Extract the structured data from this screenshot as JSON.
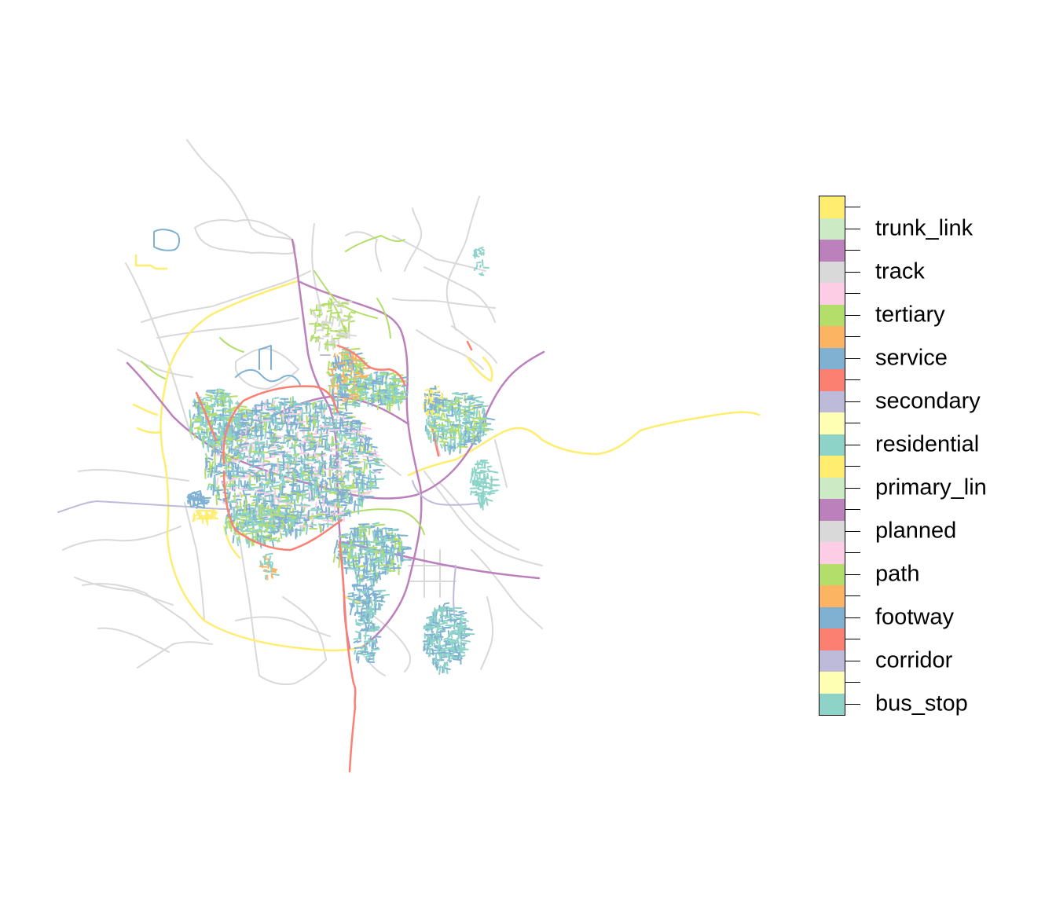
{
  "map": {
    "title": "",
    "palette": {
      "bus_stop": "#8DD3C7",
      "corridor": "#BEBADA",
      "footway": "#80B1D3",
      "path": "#B3DE69",
      "planned": "#D9D9D9",
      "primary_link": "#CCEBC5",
      "residential": "#8DD3C7",
      "secondary": "#FB8072",
      "service": "#80B1D3",
      "tertiary": "#B3DE69",
      "track": "#D9D9D9",
      "trunk_link": "#CCEBC5",
      "primary": "#FFED6F",
      "motorway": "#BC80BD",
      "unclassified": "#FFFFB3",
      "steps": "#FDB462",
      "pedestrian": "#FCCDE5",
      "living_street": "#FFFFB3"
    }
  },
  "legend": {
    "cells": [
      "#FFED6F",
      "#CCEBC5",
      "#BC80BD",
      "#D9D9D9",
      "#FCCDE5",
      "#B3DE69",
      "#FDB462",
      "#80B1D3",
      "#FB8072",
      "#BEBADA",
      "#FFFFB3",
      "#8DD3C7",
      "#FFED6F",
      "#CCEBC5",
      "#BC80BD",
      "#D9D9D9",
      "#FCCDE5",
      "#B3DE69",
      "#FDB462",
      "#80B1D3",
      "#FB8072",
      "#BEBADA",
      "#FFFFB3",
      "#8DD3C7"
    ],
    "labels": [
      "trunk_link",
      "track",
      "tertiary",
      "service",
      "secondary",
      "residential",
      "primary_lin",
      "planned",
      "path",
      "footway",
      "corridor",
      "bus_stop"
    ]
  }
}
